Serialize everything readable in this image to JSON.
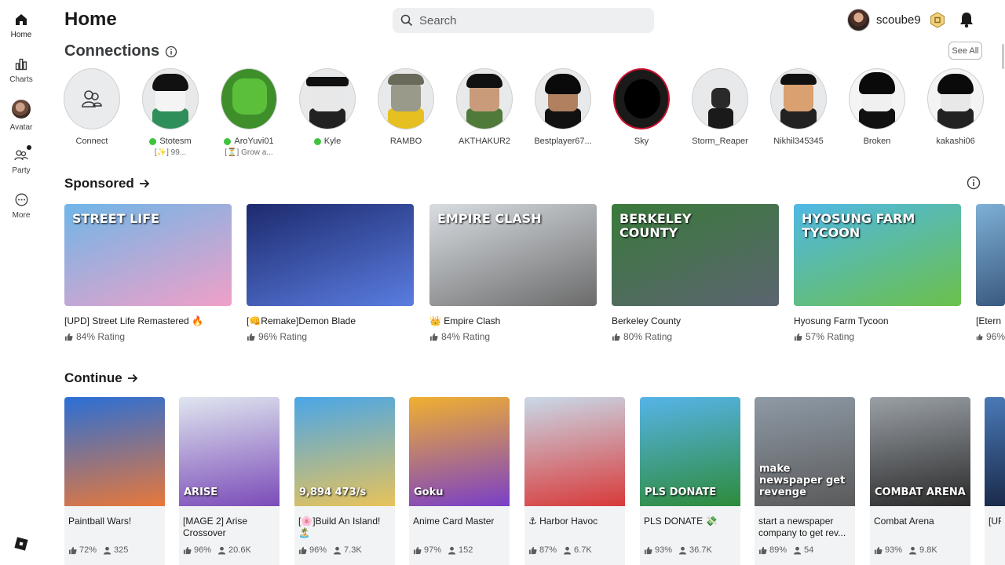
{
  "sidebar": {
    "items": [
      {
        "label": "Home",
        "icon": "home-icon"
      },
      {
        "label": "Charts",
        "icon": "charts-icon"
      },
      {
        "label": "Avatar",
        "icon": "avatar-icon"
      },
      {
        "label": "Party",
        "icon": "party-icon"
      },
      {
        "label": "More",
        "icon": "more-icon"
      }
    ]
  },
  "header": {
    "title": "Home",
    "search_placeholder": "Search",
    "username": "scoube9"
  },
  "connections": {
    "title": "Connections",
    "see_all": "See All",
    "friends": [
      {
        "name": "Connect",
        "status": "",
        "online": false
      },
      {
        "name": "Stotesm",
        "status": "[✨] 99...",
        "online": true
      },
      {
        "name": "AroYuvi01",
        "status": "[⏳] Grow a...",
        "online": true
      },
      {
        "name": "Kyle",
        "status": "",
        "online": true
      },
      {
        "name": "RAMBO",
        "status": "",
        "online": false
      },
      {
        "name": "AKTHAKUR2",
        "status": "",
        "online": false
      },
      {
        "name": "Bestplayer67...",
        "status": "",
        "online": false
      },
      {
        "name": "Sky",
        "status": "",
        "online": false
      },
      {
        "name": "Storm_Reaper",
        "status": "",
        "online": false
      },
      {
        "name": "Nikhil345345",
        "status": "",
        "online": false
      },
      {
        "name": "Broken",
        "status": "",
        "online": false
      },
      {
        "name": "kakashi06",
        "status": "",
        "online": false
      }
    ]
  },
  "sponsored": {
    "title": "Sponsored",
    "games": [
      {
        "title": "[UPD] Street Life Remastered 🔥",
        "rating": "84% Rating",
        "thumb_text": "STREET LIFE",
        "colors": [
          "#6fb6e8",
          "#f0a0c8"
        ]
      },
      {
        "title": "[👊Remake]Demon Blade",
        "rating": "96% Rating",
        "thumb_text": "",
        "colors": [
          "#1d2a6e",
          "#5a7de0"
        ]
      },
      {
        "title": "👑 Empire Clash",
        "rating": "84% Rating",
        "thumb_text": "EMPIRE CLASH",
        "colors": [
          "#d8dde2",
          "#6b6b6b"
        ]
      },
      {
        "title": "Berkeley County",
        "rating": "80% Rating",
        "thumb_text": "BERKELEY COUNTY",
        "colors": [
          "#3a7a3a",
          "#5b6470"
        ]
      },
      {
        "title": "Hyosung Farm Tycoon",
        "rating": "57% Rating",
        "thumb_text": "HYOSUNG FARM TYCOON",
        "colors": [
          "#4fb8e6",
          "#6bc04a"
        ]
      },
      {
        "title": "[Etern",
        "rating": "96%",
        "thumb_text": "",
        "colors": [
          "#7fb0d6",
          "#3a5a80"
        ]
      }
    ]
  },
  "continue": {
    "title": "Continue",
    "games": [
      {
        "title": "Paintball Wars!",
        "rating": "72%",
        "players": "325",
        "thumb_text": "",
        "colors": [
          "#2a6fd6",
          "#e8783a"
        ]
      },
      {
        "title": "[MAGE 2] Arise Crossover",
        "rating": "96%",
        "players": "20.6K",
        "thumb_text": "ARISE",
        "colors": [
          "#dfe6ef",
          "#7b4bb8"
        ]
      },
      {
        "title": "[🌸]Build An Island! 🏝️",
        "rating": "96%",
        "players": "7.3K",
        "thumb_text": "9,894 473/s",
        "colors": [
          "#4aa6e8",
          "#e8c35a"
        ]
      },
      {
        "title": "Anime Card Master",
        "rating": "97%",
        "players": "152",
        "thumb_text": "Goku",
        "colors": [
          "#f0b030",
          "#7a3fc8"
        ]
      },
      {
        "title": "⚓ Harbor Havoc",
        "rating": "87%",
        "players": "6.7K",
        "thumb_text": "",
        "colors": [
          "#c9d9e8",
          "#d83a3a"
        ]
      },
      {
        "title": "PLS DONATE 💸",
        "rating": "93%",
        "players": "36.7K",
        "thumb_text": "PLS DONATE",
        "colors": [
          "#56b4e9",
          "#2e8b3a"
        ]
      },
      {
        "title": "start a newspaper company to get rev...",
        "rating": "89%",
        "players": "54",
        "thumb_text": "make newspaper get revenge",
        "colors": [
          "#8e9aa6",
          "#5a5a5a"
        ]
      },
      {
        "title": "Combat Arena",
        "rating": "93%",
        "players": "9.8K",
        "thumb_text": "COMBAT ARENA",
        "colors": [
          "#9aa0a6",
          "#2a2a2a"
        ]
      },
      {
        "title": "[UF",
        "rating": "",
        "players": "",
        "thumb_text": "",
        "colors": [
          "#4a7ab8",
          "#1a2a4a"
        ]
      }
    ]
  }
}
